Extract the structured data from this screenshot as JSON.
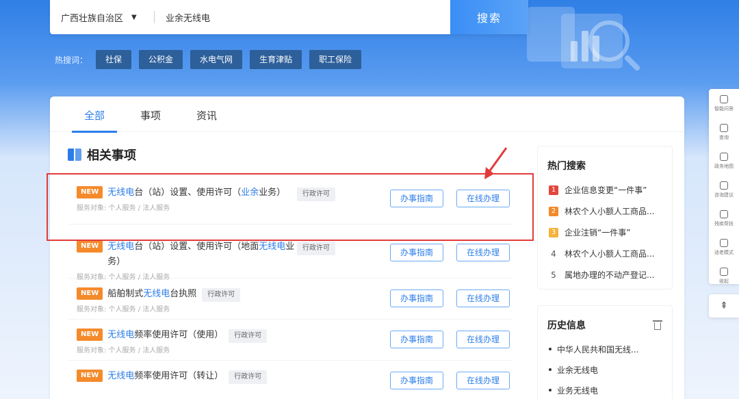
{
  "search": {
    "region": "广西壮族自治区",
    "query": "业余无线电",
    "button": "搜索"
  },
  "hot_words": {
    "label": "热搜词：",
    "tags": [
      "社保",
      "公积金",
      "水电气网",
      "生育津贴",
      "职工保险"
    ]
  },
  "tabs": [
    "全部",
    "事项",
    "资讯"
  ],
  "section_title": "相关事项",
  "items": [
    {
      "badge": "NEW",
      "title_parts": [
        {
          "text": "无线电",
          "hl": true
        },
        {
          "text": "台（站）设置、使用许可（",
          "hl": false
        },
        {
          "text": "业余",
          "hl": true
        },
        {
          "text": "业务）",
          "hl": false
        }
      ],
      "type": "行政许可",
      "meta": "服务对象: 个人服务 / 法人服务",
      "guide": "办事指南",
      "online": "在线办理"
    },
    {
      "badge": "NEW",
      "title_parts": [
        {
          "text": "无线电",
          "hl": true
        },
        {
          "text": "台（站）设置、使用许可（地面",
          "hl": false
        },
        {
          "text": "无线电",
          "hl": true
        },
        {
          "text": "业务）",
          "hl": false
        }
      ],
      "type": "行政许可",
      "meta": "服务对象: 个人服务 / 法人服务",
      "guide": "办事指南",
      "online": "在线办理"
    },
    {
      "badge": "NEW",
      "title_parts": [
        {
          "text": "船舶制式",
          "hl": false
        },
        {
          "text": "无线电",
          "hl": true
        },
        {
          "text": "台执照",
          "hl": false
        }
      ],
      "type": "行政许可",
      "meta": "服务对象: 个人服务 / 法人服务",
      "guide": "办事指南",
      "online": "在线办理"
    },
    {
      "badge": "NEW",
      "title_parts": [
        {
          "text": "无线电",
          "hl": true
        },
        {
          "text": "频率使用许可（使用）",
          "hl": false
        }
      ],
      "type": "行政许可",
      "meta": "服务对象: 个人服务 / 法人服务",
      "guide": "办事指南",
      "online": "在线办理"
    },
    {
      "badge": "NEW",
      "title_parts": [
        {
          "text": "无线电",
          "hl": true
        },
        {
          "text": "频率使用许可（转让）",
          "hl": false
        }
      ],
      "type": "行政许可",
      "meta": "",
      "guide": "办事指南",
      "online": "在线办理"
    }
  ],
  "hot_search": {
    "title": "热门搜索",
    "items": [
      {
        "rank": "1",
        "text": "企业信息变更“一件事”"
      },
      {
        "rank": "2",
        "text": "林农个人小额人工商品..."
      },
      {
        "rank": "3",
        "text": "企业注销“一件事”"
      },
      {
        "rank": "4",
        "text": "林农个人小额人工商品..."
      },
      {
        "rank": "5",
        "text": "属地办理的不动产登记..."
      }
    ]
  },
  "history": {
    "title": "历史信息",
    "items": [
      "中华人民共和国无线...",
      "业余无线电",
      "业务无线电"
    ]
  },
  "float_bar": {
    "items": [
      {
        "icon": "robot-icon",
        "label": "智能问答"
      },
      {
        "icon": "search-icon",
        "label": "查询"
      },
      {
        "icon": "map-icon",
        "label": "政务地图"
      },
      {
        "icon": "chat-icon",
        "label": "咨询建议"
      },
      {
        "icon": "person-icon",
        "label": "残疾帮扶"
      },
      {
        "icon": "grid-icon",
        "label": "适老模式"
      },
      {
        "icon": "collect-icon",
        "label": "收起"
      }
    ],
    "top_icon": "back-to-top-icon"
  },
  "colors": {
    "accent": "#2b7de9",
    "badge": "#f58a2b",
    "highlight_frame": "#e23b3b"
  }
}
